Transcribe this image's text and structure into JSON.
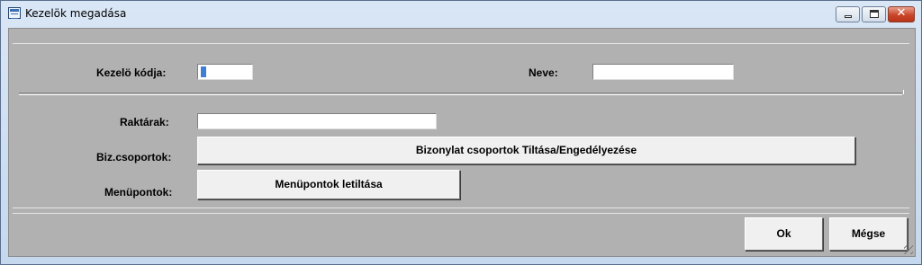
{
  "window": {
    "title": "Kezelök megadása",
    "controls": {
      "minimize": "minimize",
      "maximize": "maximize",
      "close": "✕"
    }
  },
  "form": {
    "kezelo_kodja_label": "Kezelö kódja:",
    "kezelo_kodja_value": "",
    "neve_label": "Neve:",
    "neve_value": "",
    "raktarak_label": "Raktárak:",
    "raktarak_value": "",
    "biz_csoportok_label": "Biz.csoportok:",
    "biz_csoportok_button": "Bizonylat csoportok Tiltása/Engedélyezése",
    "menupontok_label": "Menüpontok:",
    "menupontok_button": "Menüpontok letiltása"
  },
  "actions": {
    "ok": "Ok",
    "cancel": "Mégse"
  },
  "colors": {
    "client_bg": "#b1b1b1",
    "title_bg": "#d9e6f5",
    "close_btn": "#c9452a",
    "caret": "#3d7fd6"
  },
  "icons": [
    "app-window-icon",
    "minimize-icon",
    "maximize-icon",
    "close-icon",
    "resize-grip-icon"
  ]
}
